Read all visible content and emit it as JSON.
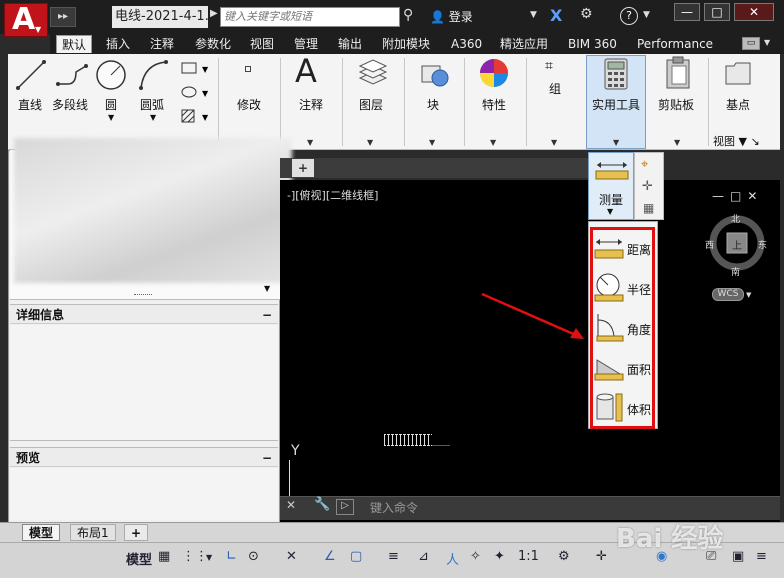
{
  "titlebar": {
    "app_letter": "A",
    "doc_title": "电线-2021-4-1...",
    "search_placeholder": "键入关键字或短语",
    "login_label": "登录",
    "help_label": "?",
    "window_buttons": [
      "—",
      "□",
      "✕"
    ]
  },
  "tabs": [
    {
      "label": "默认",
      "active": true
    },
    {
      "label": "插入"
    },
    {
      "label": "注释"
    },
    {
      "label": "参数化"
    },
    {
      "label": "视图"
    },
    {
      "label": "管理"
    },
    {
      "label": "输出"
    },
    {
      "label": "附加模块"
    },
    {
      "label": "A360"
    },
    {
      "label": "精选应用"
    },
    {
      "label": "BIM 360"
    },
    {
      "label": "Performance"
    }
  ],
  "ribbon": {
    "draw": {
      "line": "直线",
      "polyline": "多段线",
      "circle": "圆",
      "arc": "圆弧"
    },
    "modify": "修改",
    "annotation": "注释",
    "layers": "图层",
    "block": "块",
    "properties": "特性",
    "groups": "组",
    "utilities": "实用工具",
    "clipboard": "剪贴板",
    "base": "基点",
    "view_footer": "视图"
  },
  "palette": {
    "details_title": "详细信息",
    "preview_title": "预览",
    "collapse_symbol": "−"
  },
  "drawing": {
    "filetab_plus": "+",
    "viewport_label": "-][俯视][二维线框]",
    "viewcube": {
      "north": "北",
      "south": "南",
      "east": "东",
      "west": "西",
      "top": "上",
      "wcs": "WCS"
    },
    "y_axis": "Y"
  },
  "measure": {
    "label": "测量",
    "items": [
      {
        "label": "距离",
        "icon": "distance-icon"
      },
      {
        "label": "半径",
        "icon": "radius-icon"
      },
      {
        "label": "角度",
        "icon": "angle-icon"
      },
      {
        "label": "面积",
        "icon": "area-icon"
      },
      {
        "label": "体积",
        "icon": "volume-icon"
      }
    ]
  },
  "command": {
    "placeholder": "键入命令"
  },
  "layout_tabs": [
    {
      "label": "模型",
      "active": true
    },
    {
      "label": "布局1"
    },
    {
      "label": "+"
    }
  ],
  "statusbar": {
    "model_label": "模型",
    "scale": "1:1"
  },
  "watermark": "Bai 经验",
  "colors": {
    "accent_red": "#e01010",
    "app_red": "#c1141a",
    "canvas_bg": "#000000"
  }
}
